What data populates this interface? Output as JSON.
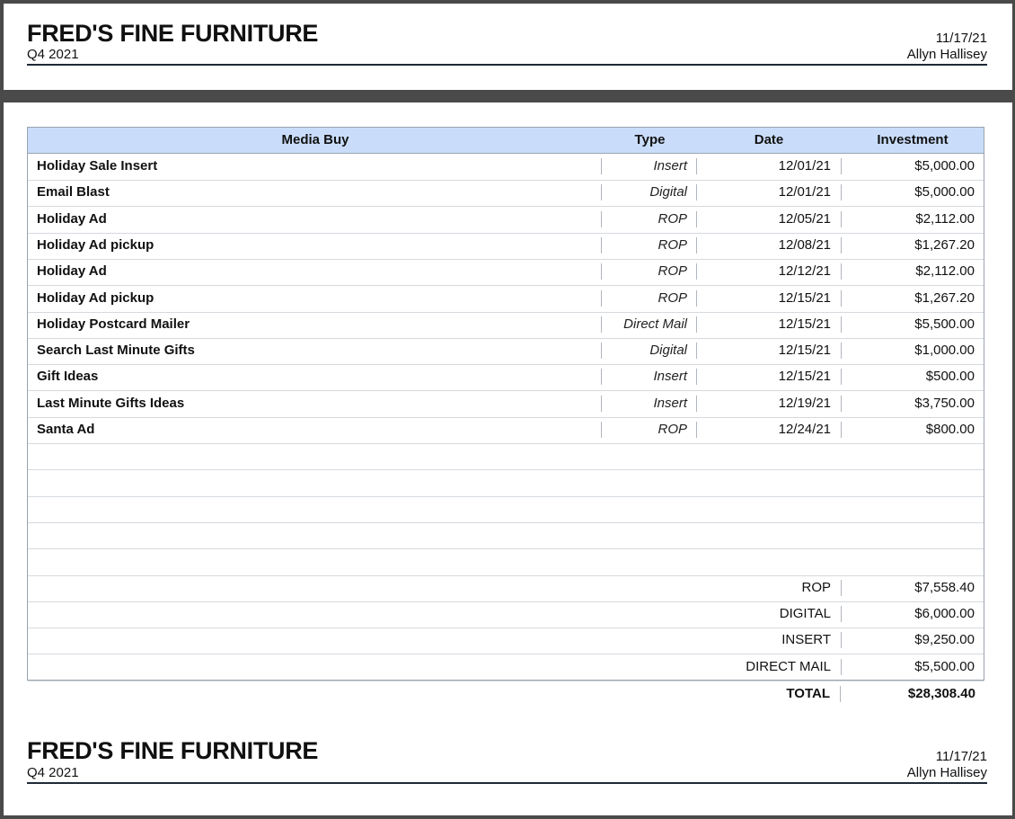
{
  "header": {
    "company": "FRED'S FINE FURNITURE",
    "quarter": "Q4 2021",
    "date": "11/17/21",
    "author": "Allyn Hallisey"
  },
  "table": {
    "columns": [
      "Media Buy",
      "Type",
      "Date",
      "Investment"
    ],
    "rows": [
      {
        "media": "Holiday Sale Insert",
        "type": "Insert",
        "date": "12/01/21",
        "investment": "$5,000.00"
      },
      {
        "media": "Email Blast",
        "type": "Digital",
        "date": "12/01/21",
        "investment": "$5,000.00"
      },
      {
        "media": "Holiday Ad",
        "type": "ROP",
        "date": "12/05/21",
        "investment": "$2,112.00"
      },
      {
        "media": "Holiday Ad pickup",
        "type": "ROP",
        "date": "12/08/21",
        "investment": "$1,267.20"
      },
      {
        "media": "Holiday Ad",
        "type": "ROP",
        "date": "12/12/21",
        "investment": "$2,112.00"
      },
      {
        "media": "Holiday Ad pickup",
        "type": "ROP",
        "date": "12/15/21",
        "investment": "$1,267.20"
      },
      {
        "media": "Holiday Postcard Mailer",
        "type": "Direct Mail",
        "date": "12/15/21",
        "investment": "$5,500.00"
      },
      {
        "media": "Search Last Minute Gifts",
        "type": "Digital",
        "date": "12/15/21",
        "investment": "$1,000.00"
      },
      {
        "media": "Gift Ideas",
        "type": "Insert",
        "date": "12/15/21",
        "investment": "$500.00"
      },
      {
        "media": "Last Minute Gifts Ideas",
        "type": "Insert",
        "date": "12/19/21",
        "investment": "$3,750.00"
      },
      {
        "media": "Santa Ad",
        "type": "ROP",
        "date": "12/24/21",
        "investment": "$800.00"
      }
    ],
    "summary": [
      {
        "label": "ROP",
        "value": "$7,558.40"
      },
      {
        "label": "DIGITAL",
        "value": "$6,000.00"
      },
      {
        "label": "INSERT",
        "value": "$9,250.00"
      },
      {
        "label": "DIRECT MAIL",
        "value": "$5,500.00"
      }
    ],
    "total": {
      "label": "TOTAL",
      "value": "$28,308.40"
    }
  }
}
